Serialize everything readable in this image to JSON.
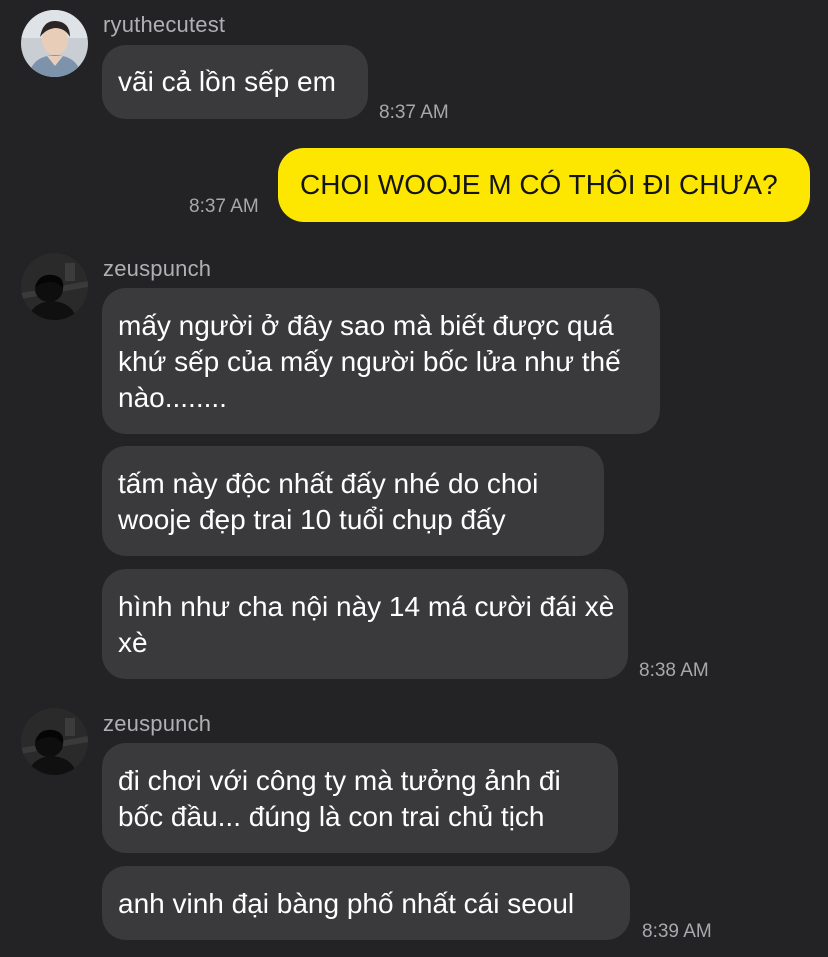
{
  "messages": [
    {
      "sender": "ryuthecutest",
      "bubbles": [
        "vãi cả lồn sếp em"
      ],
      "time": "8:37 AM"
    },
    {
      "sender": "me",
      "bubbles": [
        "CHOI WOOJE M CÓ THÔI ĐI CHƯA?"
      ],
      "time": "8:37 AM"
    },
    {
      "sender": "zeuspunch",
      "bubbles": [
        "mấy người ở đây sao mà biết được quá khứ sếp của mấy người bốc lửa như thế nào........",
        "tấm này độc nhất đấy nhé do choi wooje đẹp trai 10 tuổi chụp đấy",
        "hình như cha nội này 14 má cười đái xè xè"
      ],
      "time": "8:38 AM"
    },
    {
      "sender": "zeuspunch",
      "bubbles": [
        "đi chơi với công ty mà tưởng ảnh đi bốc đầu... đúng là con trai chủ tịch",
        "anh vinh đại bàng phố nhất cái seoul"
      ],
      "time": "8:39 AM"
    }
  ],
  "colors": {
    "background": "#232325",
    "incoming_bubble": "#3a3a3c",
    "outgoing_bubble": "#fde700",
    "timestamp": "#a8a8ac"
  },
  "icons": [
    "avatar-ryuthecutest",
    "avatar-zeuspunch"
  ]
}
